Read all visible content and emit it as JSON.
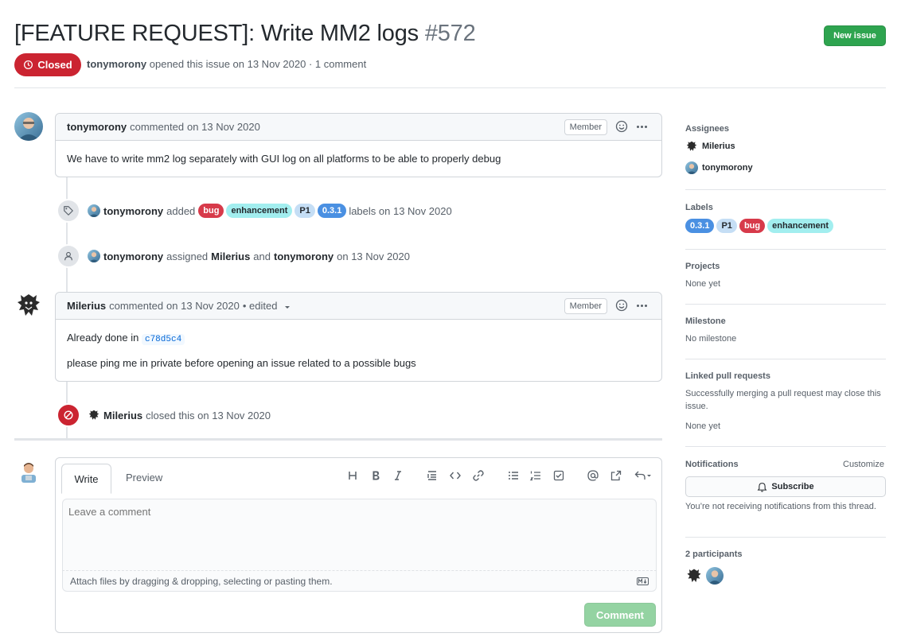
{
  "issue": {
    "title": "[FEATURE REQUEST]: Write MM2 logs",
    "number": "#572",
    "state": "Closed",
    "author": "tonymorony",
    "meta_rest": "opened this issue on 13 Nov 2020 · 1 comment",
    "new_issue_label": "New issue"
  },
  "timeline": {
    "comment1": {
      "author": "tonymorony",
      "action": "commented",
      "date": "on 13 Nov 2020",
      "badge": "Member",
      "body": "We have to write mm2 log separately with GUI log on all platforms to be able to properly debug"
    },
    "labels_event": {
      "actor": "tonymorony",
      "verb": "added",
      "suffix": "labels on 13 Nov 2020",
      "labels": [
        {
          "name": "bug",
          "bg": "#d73a4a",
          "fg": "#ffffff"
        },
        {
          "name": "enhancement",
          "bg": "#a2eeef",
          "fg": "#24292e"
        },
        {
          "name": "P1",
          "bg": "#c5def5",
          "fg": "#24292e"
        },
        {
          "name": "0.3.1",
          "bg": "#4a90e2",
          "fg": "#ffffff"
        }
      ]
    },
    "assign_event": {
      "actor": "tonymorony",
      "verb": "assigned",
      "user1": "Milerius",
      "and": "and",
      "user2": "tonymorony",
      "date": "on 13 Nov 2020"
    },
    "comment2": {
      "author": "Milerius",
      "action": "commented",
      "date": "on 13 Nov 2020",
      "edited": "• edited",
      "badge": "Member",
      "line1_prefix": "Already done in",
      "commit": "c78d5c4",
      "line2": "please ping me in private before opening an issue related to a possible bugs"
    },
    "close_event": {
      "actor": "Milerius",
      "text": "closed this on 13 Nov 2020"
    }
  },
  "editor": {
    "tab_write": "Write",
    "tab_preview": "Preview",
    "placeholder": "Leave a comment",
    "attach_hint": "Attach files by dragging & dropping, selecting or pasting them.",
    "submit_label": "Comment",
    "toolbar_icons": [
      "heading-icon",
      "bold-icon",
      "italic-icon",
      "quote-icon",
      "code-icon",
      "link-icon",
      "bulleted-list-icon",
      "numbered-list-icon",
      "task-list-icon",
      "mention-icon",
      "cross-reference-icon",
      "reply-icon"
    ]
  },
  "sidebar": {
    "assignees_title": "Assignees",
    "assignees": [
      "Milerius",
      "tonymorony"
    ],
    "labels_title": "Labels",
    "labels": [
      {
        "name": "0.3.1",
        "bg": "#4a90e2",
        "fg": "#ffffff"
      },
      {
        "name": "P1",
        "bg": "#c5def5",
        "fg": "#24292e"
      },
      {
        "name": "bug",
        "bg": "#d73a4a",
        "fg": "#ffffff"
      },
      {
        "name": "enhancement",
        "bg": "#a2eeef",
        "fg": "#24292e"
      }
    ],
    "projects_title": "Projects",
    "projects_value": "None yet",
    "milestone_title": "Milestone",
    "milestone_value": "No milestone",
    "linked_title": "Linked pull requests",
    "linked_desc": "Successfully merging a pull request may close this issue.",
    "linked_value": "None yet",
    "notifications_title": "Notifications",
    "customize": "Customize",
    "subscribe": "Subscribe",
    "notif_desc": "You’re not receiving notifications from this thread.",
    "participants_title": "2 participants"
  }
}
